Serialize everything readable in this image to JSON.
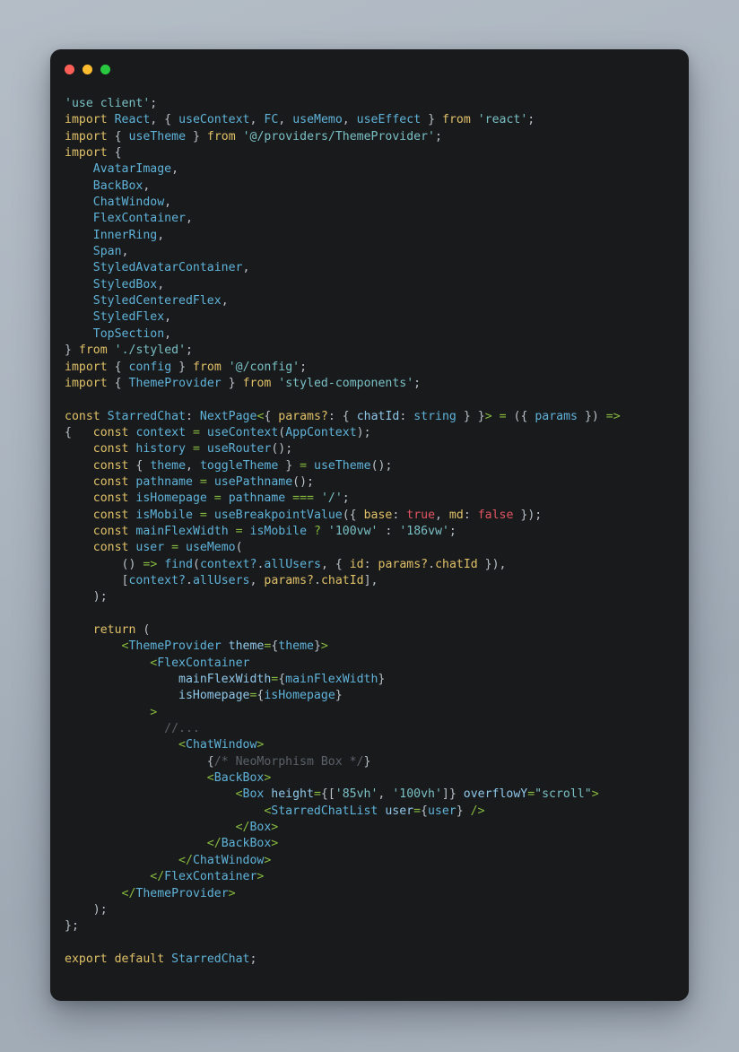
{
  "window": {
    "background_color": "#191a1c",
    "page_background": "#aab4be",
    "traffic_lights": [
      {
        "name": "close",
        "color": "#ff5f57"
      },
      {
        "name": "minimize",
        "color": "#febc2e"
      },
      {
        "name": "maximize",
        "color": "#28c840"
      }
    ]
  },
  "theme": {
    "keyword": "#e0c168",
    "identifier": "#5fb3d9",
    "string": "#79c0c4",
    "operator": "#87bb3f",
    "boolean": "#e05561",
    "comment": "#5a6169",
    "punctuation": "#b8c0c8",
    "attribute": "#8fc7e8"
  },
  "code": {
    "language": "tsx",
    "filename_hint": "StarredChat",
    "lines": [
      "'use client';",
      "import React, { useContext, FC, useMemo, useEffect } from 'react';",
      "import { useTheme } from '@/providers/ThemeProvider';",
      "import {",
      "    AvatarImage,",
      "    BackBox,",
      "    ChatWindow,",
      "    FlexContainer,",
      "    InnerRing,",
      "    Span,",
      "    StyledAvatarContainer,",
      "    StyledBox,",
      "    StyledCenteredFlex,",
      "    StyledFlex,",
      "    TopSection,",
      "} from './styled';",
      "import { config } from '@/config';",
      "import { ThemeProvider } from 'styled-components';",
      "",
      "const StarredChat: NextPage<{ params?: { chatId: string } }> = ({ params }) =>",
      "{   const context = useContext(AppContext);",
      "    const history = useRouter();",
      "    const { theme, toggleTheme } = useTheme();",
      "    const pathname = usePathname();",
      "    const isHomepage = pathname === '/';",
      "    const isMobile = useBreakpointValue({ base: true, md: false });",
      "    const mainFlexWidth = isMobile ? '100vw' : '186vw';",
      "    const user = useMemo(",
      "        () => find(context?.allUsers, { id: params?.chatId }),",
      "        [context?.allUsers, params?.chatId],",
      "    );",
      "",
      "    return (",
      "        <ThemeProvider theme={theme}>",
      "            <FlexContainer",
      "                mainFlexWidth={mainFlexWidth}",
      "                isHomepage={isHomepage}",
      "            >",
      "              //...",
      "                <ChatWindow>",
      "                    {/* NeoMorphism Box */}",
      "                    <BackBox>",
      "                        <Box height={['85vh', '100vh']} overflowY=\"scroll\">",
      "                            <StarredChatList user={user} />",
      "                        </Box>",
      "                    </BackBox>",
      "                </ChatWindow>",
      "            </FlexContainer>",
      "        </ThemeProvider>",
      "    );",
      "};",
      "",
      "export default StarredChat;"
    ]
  }
}
